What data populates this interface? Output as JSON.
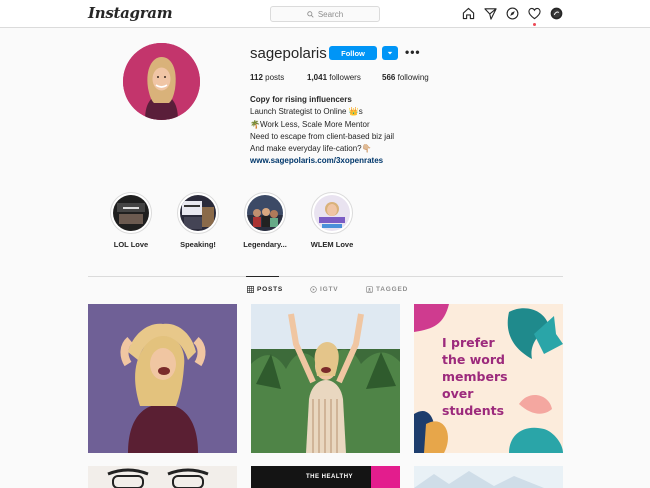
{
  "nav": {
    "logo": "Instagram",
    "search_placeholder": "Search",
    "icons": [
      "home-icon",
      "direct-icon",
      "explore-icon",
      "activity-heart-icon",
      "profile-avatar-icon"
    ],
    "notification_dot_color": "#ed4956"
  },
  "profile": {
    "username": "sagepolaris",
    "follow_label": "Follow",
    "more_label": "•••",
    "stats": {
      "posts_count": "112",
      "posts_label": "posts",
      "followers_count": "1,041",
      "followers_label": "followers",
      "following_count": "566",
      "following_label": "following"
    },
    "bio": {
      "name": "Copy for rising influencers",
      "line1": "Launch Strategist to Online 👑s",
      "line2": "🌴Work Less, Scale More Mentor",
      "line3": "Need to escape from client-based biz jail",
      "line4": "And make everyday life-cation?👇🏼",
      "link": "www.sagepolaris.com/3xopenrates"
    }
  },
  "highlights": [
    {
      "label": "LOL Love"
    },
    {
      "label": "Speaking!"
    },
    {
      "label": "Legendary..."
    },
    {
      "label": "WLEM Love"
    }
  ],
  "tabs": [
    {
      "label": "POSTS",
      "active": true
    },
    {
      "label": "IGTV",
      "active": false
    },
    {
      "label": "TAGGED",
      "active": false
    }
  ],
  "posts": {
    "quote_line1": "I prefer",
    "quote_line2": "the word",
    "quote_line3": "members",
    "quote_line4": "over",
    "quote_line5": "students",
    "partial_caption": "THE HEALTHY"
  },
  "colors": {
    "accent_blue": "#0095f6",
    "link_blue": "#00376b",
    "avatar_bg": "#c0306a",
    "quote_text": "#9c2a7c"
  }
}
